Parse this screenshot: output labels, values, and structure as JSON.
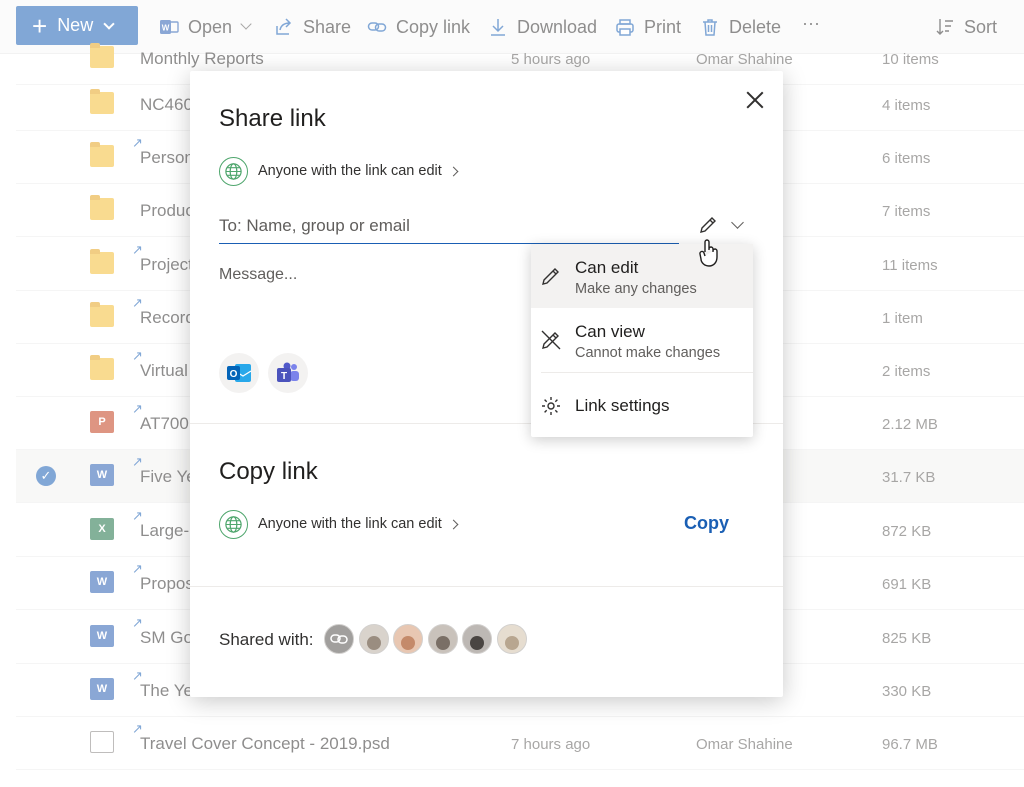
{
  "commandbar": {
    "new_label": "New",
    "items": [
      {
        "label": "Open",
        "icon": "word-open-icon",
        "has_chevron": true
      },
      {
        "label": "Share",
        "icon": "share-icon"
      },
      {
        "label": "Copy link",
        "icon": "link-icon"
      },
      {
        "label": "Download",
        "icon": "download-icon"
      },
      {
        "label": "Print",
        "icon": "print-icon"
      },
      {
        "label": "Delete",
        "icon": "trash-icon"
      },
      {
        "label": "···",
        "icon": "more-icon"
      },
      {
        "label": "Sort",
        "icon": "sort-icon"
      }
    ]
  },
  "files": [
    {
      "name": "Monthly Reports",
      "type": "shared-folder",
      "modified": "5 hours ago",
      "modified_by": "Omar Shahine",
      "size": "10 items"
    },
    {
      "name": "NC460",
      "type": "shared-folder",
      "size": "4 items"
    },
    {
      "name": "Person",
      "type": "folder",
      "size": "6 items"
    },
    {
      "name": "Produc",
      "type": "shared-folder",
      "size": "7 items"
    },
    {
      "name": "Project",
      "type": "folder",
      "size": "11 items"
    },
    {
      "name": "Record",
      "type": "folder",
      "size": "1 item"
    },
    {
      "name": "Virtual",
      "type": "folder",
      "size": "2 items"
    },
    {
      "name": "AT700",
      "type": "ppt",
      "size": "2.12 MB"
    },
    {
      "name": "Five Ye",
      "type": "word",
      "size": "31.7 KB",
      "selected": true
    },
    {
      "name": "Large-",
      "type": "excel",
      "size": "872 KB"
    },
    {
      "name": "Propos",
      "type": "word",
      "size": "691 KB"
    },
    {
      "name": "SM Go",
      "type": "word",
      "size": "825 KB"
    },
    {
      "name": "The Ye",
      "type": "word",
      "size": "330 KB"
    },
    {
      "name": "Travel Cover Concept - 2019.psd",
      "type": "image",
      "modified": "7 hours ago",
      "modified_by": "Omar Shahine",
      "size": "96.7 MB"
    }
  ],
  "dialog": {
    "share_title": "Share link",
    "share_scope": "Anyone with the link can edit",
    "to_placeholder": "To: Name, group or email",
    "message_placeholder": "Message...",
    "copy_title": "Copy link",
    "copy_scope": "Anyone with the link can edit",
    "copy_button": "Copy",
    "shared_with_label": "Shared with:",
    "avatars": [
      {
        "kind": "link-icon",
        "color": "#a19f9d"
      },
      {
        "kind": "person",
        "color": "#9a8d80"
      },
      {
        "kind": "person",
        "color": "#c48a6a"
      },
      {
        "kind": "person",
        "color": "#7a6f66"
      },
      {
        "kind": "person",
        "color": "#4a4542"
      },
      {
        "kind": "person",
        "color": "#b8a690"
      }
    ]
  },
  "permissions_menu": {
    "items": [
      {
        "title": "Can edit",
        "subtitle": "Make any changes",
        "icon": "pencil-icon",
        "active": true
      },
      {
        "title": "Can view",
        "subtitle": "Cannot make changes",
        "icon": "no-edit-icon",
        "active": false
      },
      {
        "title": "Link settings",
        "subtitle": "",
        "icon": "gear-icon",
        "active": false
      }
    ]
  },
  "colors": {
    "accent": "#1a5fb4",
    "globe": "#4fa66d",
    "folder": "#f5bd36"
  }
}
